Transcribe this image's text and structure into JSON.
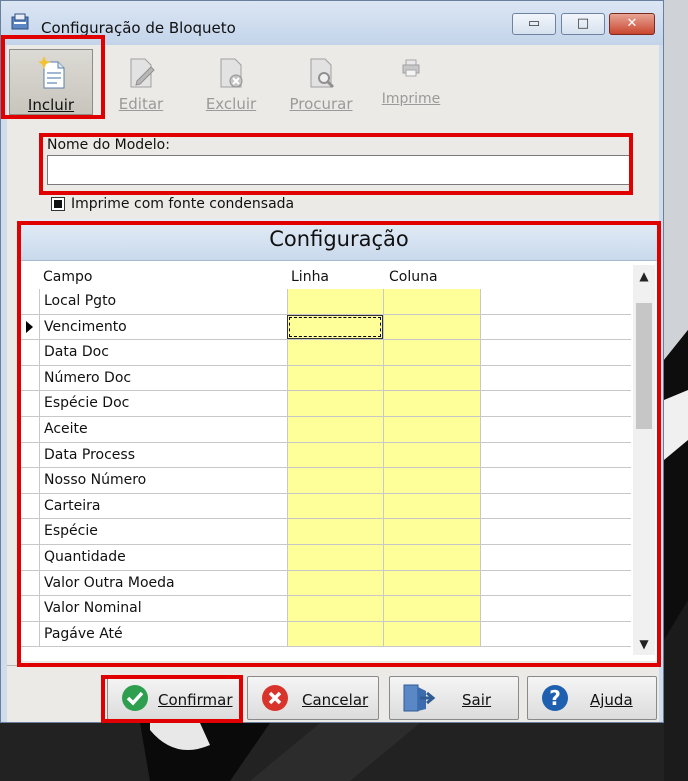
{
  "window": {
    "title": "Configuração de Bloqueto",
    "controls": {
      "minimize": "▭",
      "maximize": "□",
      "close": "✕"
    }
  },
  "toolbar": {
    "items": [
      {
        "label": "Incluir",
        "enabled": true,
        "icon": "new-document-icon"
      },
      {
        "label": "Editar",
        "enabled": false,
        "icon": "edit-document-icon"
      },
      {
        "label": "Excluir",
        "enabled": false,
        "icon": "delete-document-icon"
      },
      {
        "label": "Procurar",
        "enabled": false,
        "icon": "search-document-icon"
      },
      {
        "label": "Imprime",
        "enabled": false,
        "icon": "printer-icon"
      }
    ]
  },
  "form": {
    "model_name_label": "Nome do Modelo:",
    "model_name_value": "",
    "condensed_label": "Imprime com fonte condensada",
    "condensed_checked": true
  },
  "grid": {
    "title": "Configuração",
    "columns": [
      "Campo",
      "Linha",
      "Coluna"
    ],
    "rows": [
      {
        "campo": "Local Pgto",
        "linha": "",
        "coluna": ""
      },
      {
        "campo": "Vencimento",
        "linha": "",
        "coluna": ""
      },
      {
        "campo": "Data Doc",
        "linha": "",
        "coluna": ""
      },
      {
        "campo": "Número Doc",
        "linha": "",
        "coluna": ""
      },
      {
        "campo": "Espécie Doc",
        "linha": "",
        "coluna": ""
      },
      {
        "campo": "Aceite",
        "linha": "",
        "coluna": ""
      },
      {
        "campo": "Data Process",
        "linha": "",
        "coluna": ""
      },
      {
        "campo": "Nosso Número",
        "linha": "",
        "coluna": ""
      },
      {
        "campo": "Carteira",
        "linha": "",
        "coluna": ""
      },
      {
        "campo": "Espécie",
        "linha": "",
        "coluna": ""
      },
      {
        "campo": "Quantidade",
        "linha": "",
        "coluna": ""
      },
      {
        "campo": "Valor Outra Moeda",
        "linha": "",
        "coluna": ""
      },
      {
        "campo": "Valor Nominal",
        "linha": "",
        "coluna": ""
      },
      {
        "campo": "Pagáve Até",
        "linha": "",
        "coluna": ""
      }
    ],
    "current_row": 1
  },
  "buttons": {
    "confirm": "Confirmar",
    "cancel": "Cancelar",
    "exit": "Sair",
    "help": "Ajuda"
  },
  "colors": {
    "highlight": "#e00000",
    "editable_cell": "#ffff99",
    "confirm_icon": "#2e9e4f",
    "cancel_icon": "#d9342b",
    "help_icon": "#1f5fb0"
  }
}
